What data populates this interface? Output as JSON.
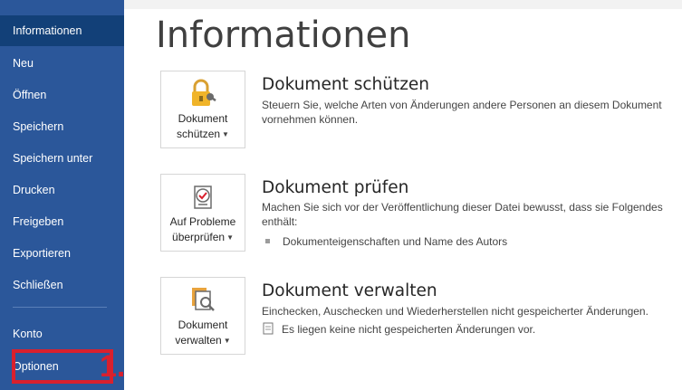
{
  "sidebar": {
    "items": [
      {
        "id": "info",
        "label": "Informationen",
        "active": true
      },
      {
        "id": "new",
        "label": "Neu"
      },
      {
        "id": "open",
        "label": "Öffnen"
      },
      {
        "id": "save",
        "label": "Speichern"
      },
      {
        "id": "saveas",
        "label": "Speichern unter"
      },
      {
        "id": "print",
        "label": "Drucken"
      },
      {
        "id": "share",
        "label": "Freigeben"
      },
      {
        "id": "export",
        "label": "Exportieren"
      },
      {
        "id": "close",
        "label": "Schließen"
      },
      {
        "id": "account",
        "label": "Konto"
      },
      {
        "id": "options",
        "label": "Optionen"
      }
    ],
    "highlight_label": "1."
  },
  "main": {
    "title": "Informationen",
    "sections": [
      {
        "id": "protect",
        "tile_line1": "Dokument",
        "tile_line2": "schützen",
        "title": "Dokument schützen",
        "desc": "Steuern Sie, welche Arten von Änderungen andere Personen an diesem Dokument vornehmen können.",
        "icon": "lock-key-icon"
      },
      {
        "id": "inspect",
        "tile_line1": "Auf Probleme",
        "tile_line2": "überprüfen",
        "title": "Dokument prüfen",
        "desc": "Machen Sie sich vor der Veröffentlichung dieser Datei bewusst, dass sie Folgendes enthält:",
        "bullet": "Dokumenteigenschaften und Name des Autors",
        "icon": "checklist-icon"
      },
      {
        "id": "manage",
        "tile_line1": "Dokument",
        "tile_line2": "verwalten",
        "title": "Dokument verwalten",
        "desc": "Einchecken, Auschecken und Wiederherstellen nicht gespeicherter Änderungen.",
        "bullet": "Es liegen keine nicht gespeicherten Änderungen vor.",
        "icon": "document-search-icon"
      }
    ]
  },
  "colors": {
    "sidebar_bg": "#2b579a",
    "sidebar_active": "#124078",
    "highlight": "#d9202d"
  }
}
